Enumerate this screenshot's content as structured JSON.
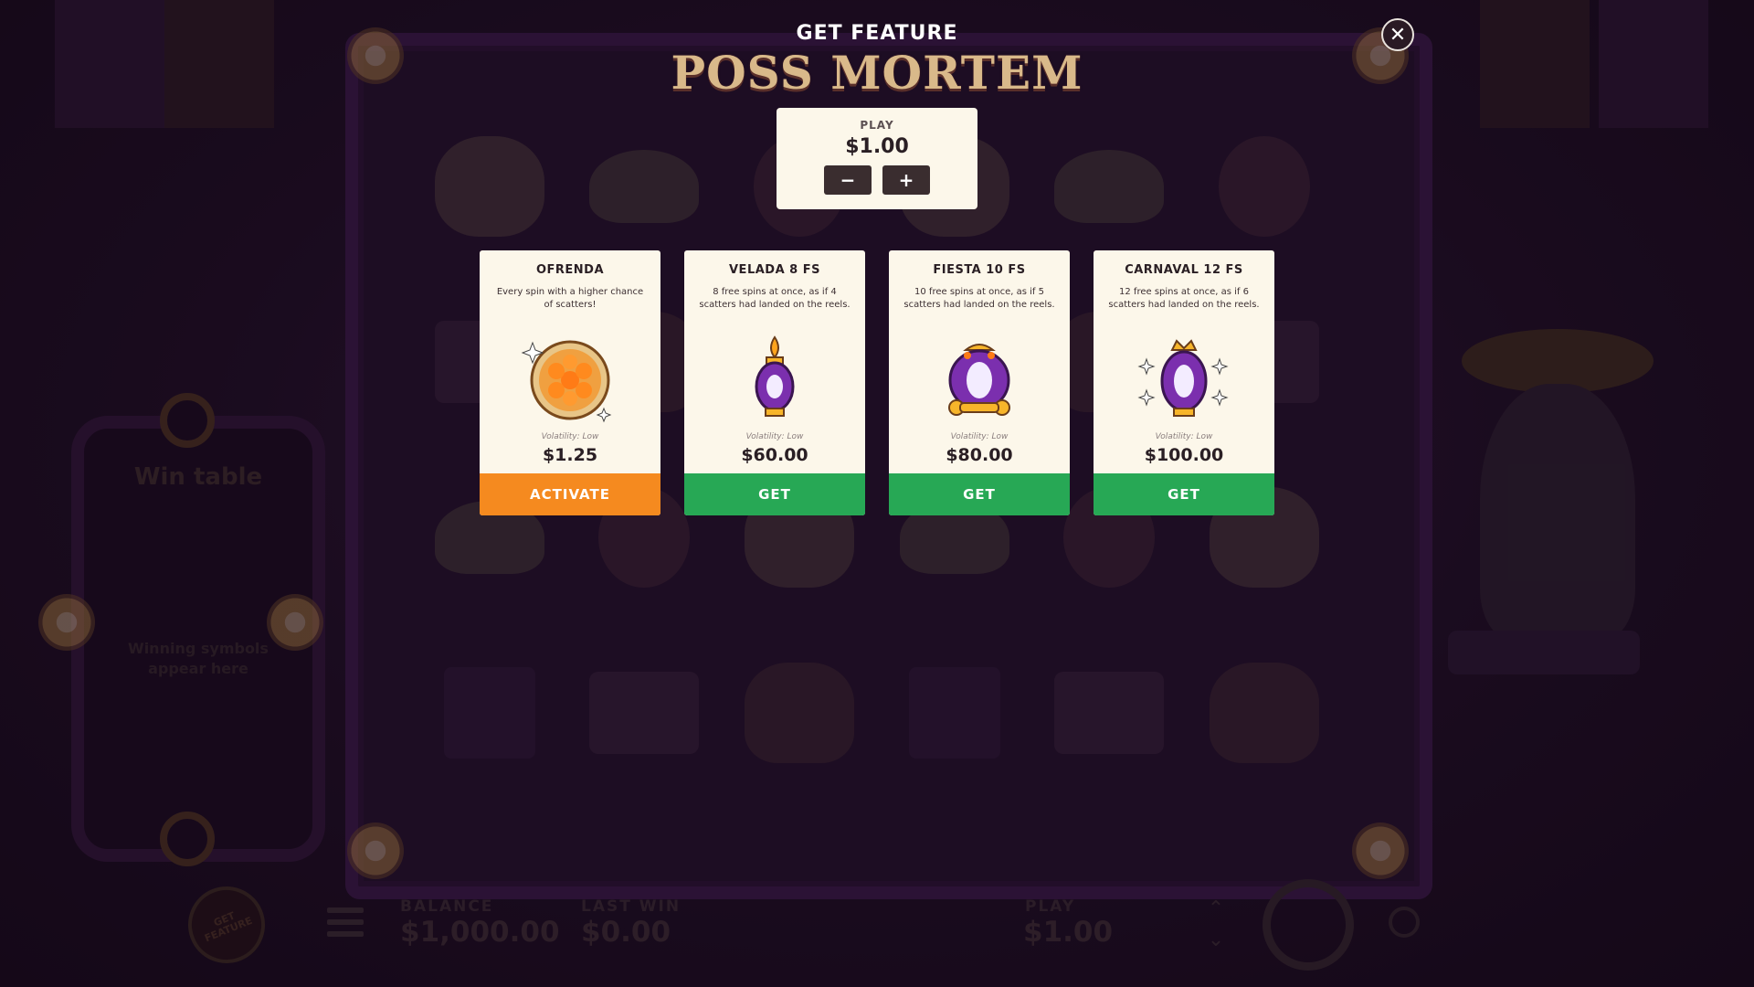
{
  "modal": {
    "title": "GET FEATURE",
    "logo": "POSS MORTEM",
    "close_icon": "close-icon"
  },
  "play_panel": {
    "label": "PLAY",
    "value": "$1.00",
    "minus": "−",
    "plus": "+"
  },
  "cards": [
    {
      "title": "OFRENDA",
      "description": "Every spin with a higher chance of scatters!",
      "icon": "orange-flower-plate-icon",
      "volatility": "Volatility: Low",
      "price": "$1.25",
      "button": "ACTIVATE",
      "button_color": "#f58a1f"
    },
    {
      "title": "VELADA 8 FS",
      "description": "8 free spins at once, as if 4 scatters had landed on the reels.",
      "icon": "purple-lantern-icon",
      "volatility": "Volatility: Low",
      "price": "$60.00",
      "button": "GET",
      "button_color": "#27a855"
    },
    {
      "title": "FIESTA 10 FS",
      "description": "10 free spins at once, as if 5 scatters had landed on the reels.",
      "icon": "purple-mirror-icon",
      "volatility": "Volatility: Low",
      "price": "$80.00",
      "button": "GET",
      "button_color": "#27a855"
    },
    {
      "title": "CARNAVAL 12 FS",
      "description": "12 free spins at once, as if 6 scatters had landed on the reels.",
      "icon": "crowned-purple-egg-icon",
      "volatility": "Volatility: Low",
      "price": "$100.00",
      "button": "GET",
      "button_color": "#27a855"
    }
  ],
  "win_table": {
    "title": "Win table",
    "subtitle": "Winning symbols appear here"
  },
  "bottom_bar": {
    "get_feature": "GET FEATURE",
    "balance_label": "BALANCE",
    "balance_value": "$1,000.00",
    "last_win_label": "LAST WIN",
    "last_win_value": "$0.00",
    "play_label": "PLAY",
    "play_value": "$1.00"
  },
  "colors": {
    "background": "#1f0f24",
    "card_bg": "#fcf7ea",
    "activate": "#f58a1f",
    "get": "#27a855"
  }
}
